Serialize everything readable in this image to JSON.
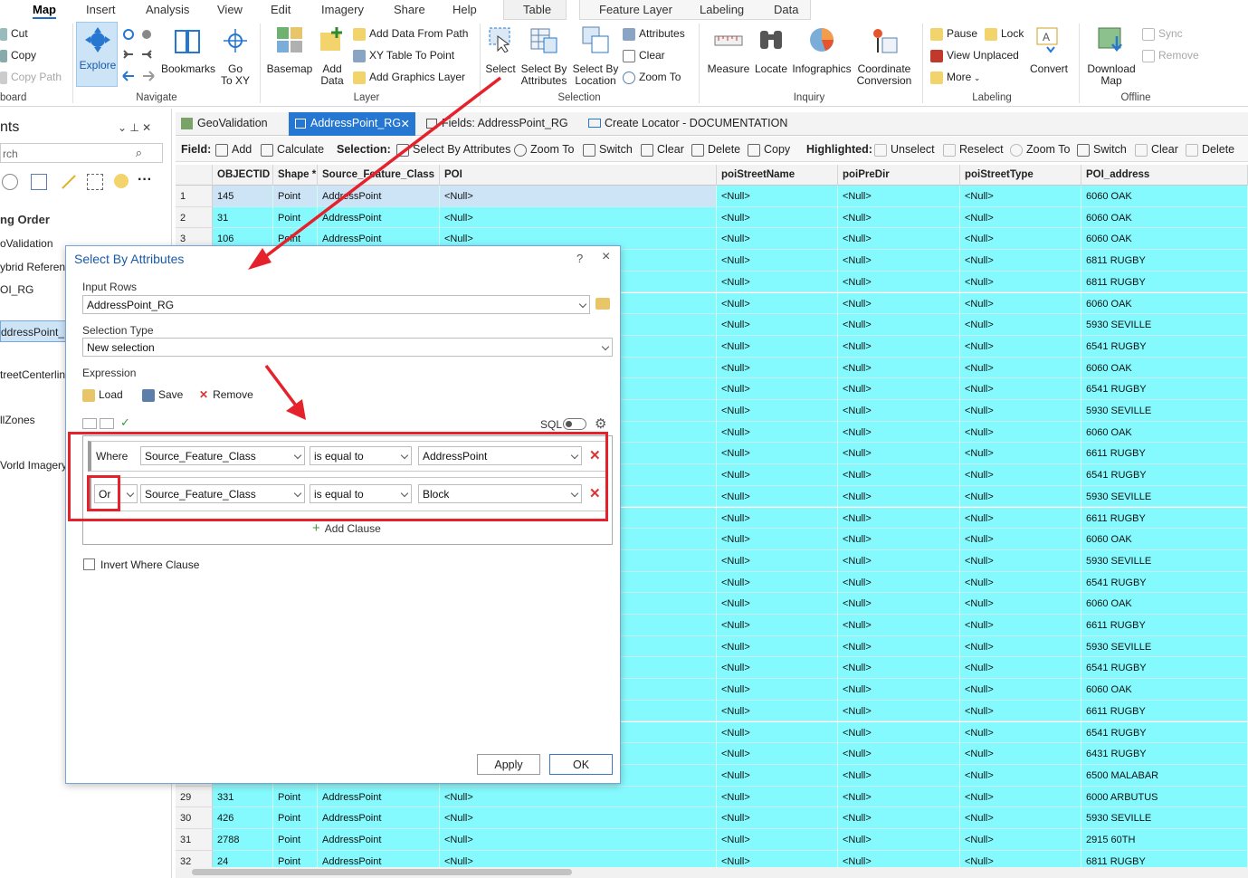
{
  "ribbon_tabs": [
    "Map",
    "Insert",
    "Analysis",
    "View",
    "Edit",
    "Imagery",
    "Share",
    "Help"
  ],
  "context_tabs": [
    "Table",
    "Feature Layer",
    "Labeling",
    "Data"
  ],
  "clipboard": {
    "cut": "Cut",
    "copy": "Copy",
    "copy_path": "Copy Path",
    "group": "board"
  },
  "navigate": {
    "explore": "Explore",
    "bookmarks": "Bookmarks",
    "goto_1": "Go",
    "goto_2": "To XY",
    "group": "Navigate"
  },
  "layer": {
    "basemap": "Basemap",
    "add_data_1": "Add",
    "add_data_2": "Data",
    "add_from_path": "Add Data From Path",
    "xy_table": "XY Table To Point",
    "add_graphics": "Add Graphics Layer",
    "group": "Layer"
  },
  "selection": {
    "select": "Select",
    "sba_1": "Select By",
    "sba_2": "Attributes",
    "sbl_1": "Select By",
    "sbl_2": "Location",
    "attributes": "Attributes",
    "clear": "Clear",
    "zoom_to": "Zoom To",
    "group": "Selection"
  },
  "inquiry": {
    "measure": "Measure",
    "locate": "Locate",
    "infographics": "Infographics",
    "coord_1": "Coordinate",
    "coord_2": "Conversion",
    "group": "Inquiry"
  },
  "labeling": {
    "pause": "Pause",
    "lock": "Lock",
    "view_unplaced": "View Unplaced",
    "more": "More",
    "convert": "Convert",
    "group": "Labeling"
  },
  "offline": {
    "download_1": "Download",
    "download_2": "Map",
    "sync": "Sync",
    "remove": "Remove",
    "group": "Offline"
  },
  "left_pane": {
    "title": "nts",
    "search_placeholder": "rch",
    "section": "ng Order",
    "items": [
      "oValidation",
      "ybrid Referen",
      "OI_RG",
      "ddressPoint_R",
      "treetCenterlin",
      "llZones",
      "Vorld Imagery"
    ]
  },
  "view_tabs": [
    "GeoValidation",
    "AddressPoint_RG",
    "Fields: AddressPoint_RG",
    "Create Locator - DOCUMENTATION"
  ],
  "table_toolbar": {
    "field": "Field:",
    "add": "Add",
    "calculate": "Calculate",
    "selection": "Selection:",
    "select_by_attributes": "Select By Attributes",
    "zoom_to": "Zoom To",
    "switch": "Switch",
    "clear": "Clear",
    "delete": "Delete",
    "copy": "Copy",
    "highlighted": "Highlighted:",
    "unselect": "Unselect",
    "reselect": "Reselect",
    "h_zoom_to": "Zoom To",
    "h_switch": "Switch",
    "h_clear": "Clear",
    "h_delete": "Delete"
  },
  "table": {
    "columns": [
      "OBJECTID *",
      "Shape *",
      "Source_Feature_Class",
      "POI",
      "poiStreetName",
      "poiPreDir",
      "poiStreetType",
      "POI_address"
    ],
    "null": "<Null>",
    "rows": [
      {
        "n": "1",
        "id": "145",
        "shape": "Point",
        "src": "AddressPoint",
        "addr": "6060 OAK"
      },
      {
        "n": "2",
        "id": "31",
        "shape": "Point",
        "src": "AddressPoint",
        "addr": "6060 OAK"
      },
      {
        "n": "3",
        "id": "106",
        "shape": "Point",
        "src": "AddressPoint",
        "addr": "6060 OAK"
      },
      {
        "n": "",
        "id": "",
        "shape": "",
        "src": "",
        "addr": "6811 RUGBY"
      },
      {
        "n": "",
        "id": "",
        "shape": "",
        "src": "",
        "addr": "6811 RUGBY"
      },
      {
        "n": "",
        "id": "",
        "shape": "",
        "src": "",
        "addr": "6060 OAK"
      },
      {
        "n": "",
        "id": "",
        "shape": "",
        "src": "",
        "addr": "5930 SEVILLE"
      },
      {
        "n": "",
        "id": "",
        "shape": "",
        "src": "",
        "addr": "6541 RUGBY"
      },
      {
        "n": "",
        "id": "",
        "shape": "",
        "src": "",
        "addr": "6060 OAK"
      },
      {
        "n": "",
        "id": "",
        "shape": "",
        "src": "",
        "addr": "6541 RUGBY"
      },
      {
        "n": "",
        "id": "",
        "shape": "",
        "src": "",
        "addr": "5930 SEVILLE"
      },
      {
        "n": "",
        "id": "",
        "shape": "",
        "src": "",
        "addr": "6060 OAK"
      },
      {
        "n": "",
        "id": "",
        "shape": "",
        "src": "",
        "addr": "6611 RUGBY"
      },
      {
        "n": "",
        "id": "",
        "shape": "",
        "src": "",
        "addr": "6541 RUGBY"
      },
      {
        "n": "",
        "id": "",
        "shape": "",
        "src": "",
        "addr": "5930 SEVILLE"
      },
      {
        "n": "",
        "id": "",
        "shape": "",
        "src": "",
        "addr": "6611 RUGBY"
      },
      {
        "n": "",
        "id": "",
        "shape": "",
        "src": "",
        "addr": "6060 OAK"
      },
      {
        "n": "",
        "id": "",
        "shape": "",
        "src": "",
        "addr": "5930 SEVILLE"
      },
      {
        "n": "",
        "id": "",
        "shape": "",
        "src": "",
        "addr": "6541 RUGBY"
      },
      {
        "n": "",
        "id": "",
        "shape": "",
        "src": "",
        "addr": "6060 OAK"
      },
      {
        "n": "",
        "id": "",
        "shape": "",
        "src": "",
        "addr": "6611 RUGBY"
      },
      {
        "n": "",
        "id": "",
        "shape": "",
        "src": "",
        "addr": "5930 SEVILLE"
      },
      {
        "n": "",
        "id": "",
        "shape": "",
        "src": "",
        "addr": "6541 RUGBY"
      },
      {
        "n": "",
        "id": "",
        "shape": "",
        "src": "",
        "addr": "6060 OAK"
      },
      {
        "n": "",
        "id": "",
        "shape": "",
        "src": "",
        "addr": "6611 RUGBY"
      },
      {
        "n": "",
        "id": "",
        "shape": "",
        "src": "",
        "addr": "6541 RUGBY"
      },
      {
        "n": "",
        "id": "",
        "shape": "",
        "src": "",
        "addr": "6431 RUGBY"
      },
      {
        "n": "",
        "id": "",
        "shape": "",
        "src": "",
        "addr": "6500 MALABAR"
      },
      {
        "n": "29",
        "id": "331",
        "shape": "Point",
        "src": "AddressPoint",
        "addr": "6000 ARBUTUS"
      },
      {
        "n": "30",
        "id": "426",
        "shape": "Point",
        "src": "AddressPoint",
        "addr": "5930 SEVILLE"
      },
      {
        "n": "31",
        "id": "2788",
        "shape": "Point",
        "src": "AddressPoint",
        "addr": "2915 60TH"
      },
      {
        "n": "32",
        "id": "24",
        "shape": "Point",
        "src": "AddressPoint",
        "addr": "6811 RUGBY"
      }
    ]
  },
  "dialog": {
    "title": "Select By Attributes",
    "help": "?",
    "close": "×",
    "input_rows_label": "Input Rows",
    "input_rows_value": "AddressPoint_RG",
    "selection_type_label": "Selection Type",
    "selection_type_value": "New selection",
    "expression_label": "Expression",
    "load": "Load",
    "save": "Save",
    "remove": "Remove",
    "sql": "SQL",
    "clause1": {
      "connector": "Where",
      "field": "Source_Feature_Class",
      "operator": "is equal to",
      "value": "AddressPoint"
    },
    "clause2": {
      "connector": "Or",
      "field": "Source_Feature_Class",
      "operator": "is equal to",
      "value": "Block"
    },
    "add_clause": "Add Clause",
    "invert": "Invert Where Clause",
    "apply": "Apply",
    "ok": "OK"
  },
  "colors": {
    "selected_fill": "#85fafe",
    "accent": "#2677d1",
    "annotation_red": "#e5222c"
  }
}
